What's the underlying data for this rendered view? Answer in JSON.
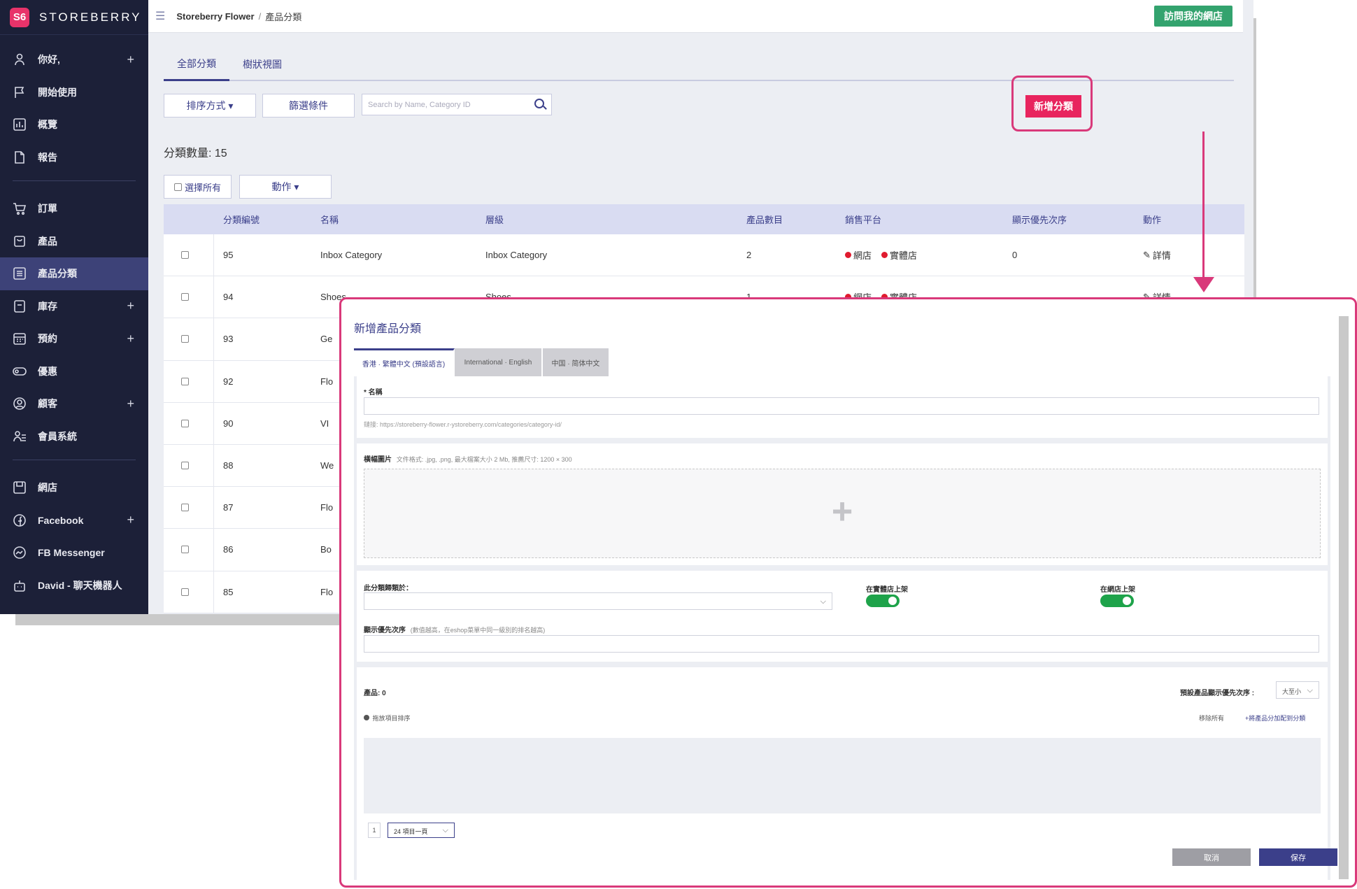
{
  "app": {
    "logo_mark": "S6",
    "name": "STOREBERRY"
  },
  "sidebar": {
    "items": [
      {
        "label": "你好,",
        "icon": "user-icon",
        "plus": "+"
      },
      {
        "label": "開始使用",
        "icon": "flag-icon"
      },
      {
        "label": "概覽",
        "icon": "bar-chart-icon"
      },
      {
        "label": "報告",
        "icon": "document-icon"
      },
      {
        "label": "訂單",
        "icon": "cart-icon"
      },
      {
        "label": "產品",
        "icon": "bag-icon"
      },
      {
        "label": "產品分類",
        "icon": "list-icon",
        "active": true
      },
      {
        "label": "庫存",
        "icon": "inventory-icon",
        "plus": "+"
      },
      {
        "label": "預約",
        "icon": "calendar-icon",
        "plus": "+"
      },
      {
        "label": "優惠",
        "icon": "ticket-icon"
      },
      {
        "label": "顧客",
        "icon": "customer-icon",
        "plus": "+"
      },
      {
        "label": "會員系統",
        "icon": "member-icon"
      },
      {
        "label": "網店",
        "icon": "store-icon"
      },
      {
        "label": "Facebook",
        "icon": "facebook-icon",
        "plus": "+"
      },
      {
        "label": "FB Messenger",
        "icon": "messenger-icon"
      },
      {
        "label": "David - 聊天機器人",
        "icon": "bot-icon"
      }
    ]
  },
  "topbar": {
    "menu_icon": "☰",
    "store_name": "Storeberry Flower",
    "separator": "/",
    "page": "產品分類",
    "visit_button": "訪問我的網店"
  },
  "tabs": {
    "all": "全部分類",
    "tree": "樹狀視圖"
  },
  "toolbar": {
    "sort": "排序方式 ▾",
    "filter": "篩選條件",
    "search_placeholder": "Search by Name, Category ID",
    "add_category": "新增分類"
  },
  "count_label": "分類數量: 15",
  "bulk": {
    "select_all": "選擇所有",
    "actions": "動作 ▾"
  },
  "table": {
    "headers": {
      "id": "分類編號",
      "name": "名稱",
      "level": "層級",
      "products": "產品數目",
      "platform": "銷售平台",
      "priority": "顯示優先次序",
      "action": "動作"
    },
    "rows": [
      {
        "id": "95",
        "name": "Inbox Category",
        "level": "Inbox Category",
        "products": "2",
        "platform_web": "網店",
        "platform_store": "實體店",
        "priority": "0",
        "action": "詳情"
      },
      {
        "id": "94",
        "name": "Shoes",
        "level": "Shoes",
        "products": "1",
        "platform_web": "網店",
        "platform_store": "實體店",
        "priority": "",
        "action": "詳情"
      },
      {
        "id": "93",
        "name": "Ge",
        "level": "",
        "products": "",
        "platform_web": "",
        "platform_store": "",
        "priority": "",
        "action": ""
      },
      {
        "id": "92",
        "name": "Flo",
        "level": "",
        "products": "",
        "platform_web": "",
        "platform_store": "",
        "priority": "",
        "action": ""
      },
      {
        "id": "90",
        "name": "VI",
        "level": "",
        "products": "",
        "platform_web": "",
        "platform_store": "",
        "priority": "",
        "action": ""
      },
      {
        "id": "88",
        "name": "We",
        "level": "",
        "products": "",
        "platform_web": "",
        "platform_store": "",
        "priority": "",
        "action": ""
      },
      {
        "id": "87",
        "name": "Flo",
        "level": "",
        "products": "",
        "platform_web": "",
        "platform_store": "",
        "priority": "",
        "action": ""
      },
      {
        "id": "86",
        "name": "Bo",
        "level": "",
        "products": "",
        "platform_web": "",
        "platform_store": "",
        "priority": "",
        "action": ""
      },
      {
        "id": "85",
        "name": "Flo",
        "level": "",
        "products": "",
        "platform_web": "",
        "platform_store": "",
        "priority": "",
        "action": ""
      }
    ]
  },
  "modal": {
    "title": "新增產品分類",
    "lang_tabs": [
      "香港 · 繁體中文 (預設語言)",
      "International · English",
      "中国 · 简体中文"
    ],
    "name_label": "* 名稱",
    "link_hint": "鏈接: https://storeberry-flower.r-ystoreberry.com/categories/category-id/",
    "banner_label": "橫幅圖片",
    "banner_hint": "文件格式: .jpg, .png, 最大檔案大小 2 Mb, 推薦尺寸: 1200 × 300",
    "upload_plus": "+",
    "parent_label": "此分類歸類於：",
    "offline_label": "在實體店上架",
    "online_label": "在網店上架",
    "priority_label": "顯示優先次序",
    "priority_hint": "(數值越高，在eshop菜單中同一級別的排名越高)",
    "products_label": "產品: 0",
    "sort_label": "預設產品顯示優先次序 :",
    "sort_value": "大至小",
    "drag_hint": "拖放項目排序",
    "remove_all": "移除所有",
    "add_products": "+將產品分加配到分類",
    "page_number": "1",
    "per_page": "24 項目一頁",
    "cancel": "取消",
    "save": "保存"
  },
  "colors": {
    "sidebar": "#1c2038",
    "accent": "#3b3f8a",
    "brand": "#e8245e",
    "highlight": "#d9397a",
    "green": "#33a36e"
  }
}
